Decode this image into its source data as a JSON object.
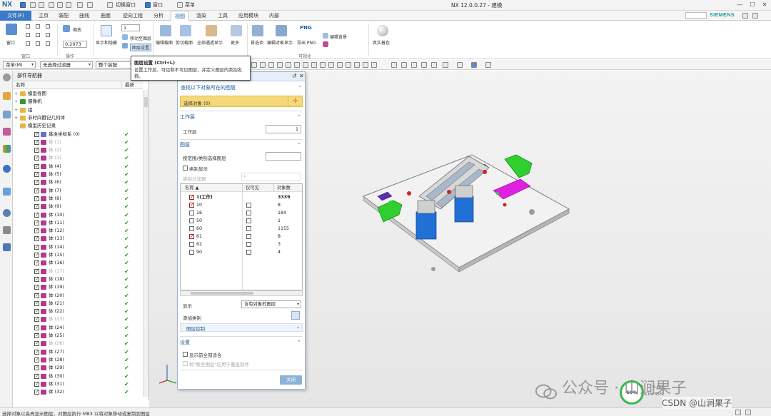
{
  "titlebar": {
    "app_logo": "NX",
    "window_switch_label": "切换窗口",
    "window_menu_label": "窗口",
    "menu_label": "菜单",
    "title": "NX 12.0.0.27 - 建模",
    "brand": "SIEMENS"
  },
  "tabs": [
    {
      "label": "文件(F)"
    },
    {
      "label": "主页"
    },
    {
      "label": "装配"
    },
    {
      "label": "曲线"
    },
    {
      "label": "曲面"
    },
    {
      "label": "逆向工程"
    },
    {
      "label": "分析"
    },
    {
      "label": "视图"
    },
    {
      "label": "渲染"
    },
    {
      "label": "工具"
    },
    {
      "label": "应用模块"
    },
    {
      "label": "内部"
    }
  ],
  "ribbon": {
    "window_btn": "窗口",
    "scale_btn": "缩放",
    "scale_value": "0.2073",
    "layer_value": "1",
    "move_to_layer": "移动至图层",
    "layer_settings": "图层设置",
    "show_hide": "显示和隐藏",
    "edit_section": "编辑截面",
    "clip_section": "剪切截面",
    "all_visible": "全部通透显示",
    "more": "更多",
    "first_select": "首选项",
    "edit_object_display": "编辑对象显示",
    "export_png": "导出 PNG",
    "edit_bg": "编辑背景",
    "faded": "真实着色",
    "png_label": "PNG",
    "group_window": "窗口",
    "group_zoom": "操作",
    "group_visible": "可视化"
  },
  "tooltip": {
    "title": "图层设置 (Ctrl+L)",
    "desc": "设置工作层、可见和不可见图层，并定义图层的类别名称。"
  },
  "filterbar": {
    "menu": "菜单(M)",
    "filter": "无选择过滤器",
    "scope": "整个装配"
  },
  "navigator": {
    "title": "部件导航器",
    "col_name": "名称",
    "col_latest": "最新",
    "rows": [
      {
        "label": "模型视图",
        "level": 0,
        "type": "folder",
        "expand": "+",
        "check": false,
        "tick": false,
        "dim": false
      },
      {
        "label": "摄像机",
        "level": 0,
        "type": "camera",
        "expand": "+",
        "check": false,
        "tick": false,
        "dim": false
      },
      {
        "label": "组",
        "level": 0,
        "type": "folder",
        "expand": "+",
        "check": false,
        "tick": false,
        "dim": false
      },
      {
        "label": "非时间戳记几何体",
        "level": 0,
        "type": "folder",
        "expand": "+",
        "check": false,
        "tick": false,
        "dim": false
      },
      {
        "label": "模型历史记录",
        "level": 0,
        "type": "folder",
        "expand": "-",
        "check": false,
        "tick": false,
        "dim": false
      },
      {
        "label": "基准坐标系 (0)",
        "level": 1,
        "type": "csys",
        "expand": "",
        "check": true,
        "tick": true,
        "dim": false
      },
      {
        "label": "体 (1)",
        "level": 1,
        "type": "body",
        "expand": "",
        "check": true,
        "tick": true,
        "dim": true
      },
      {
        "label": "体 (2)",
        "level": 1,
        "type": "body",
        "expand": "",
        "check": true,
        "tick": true,
        "dim": true
      },
      {
        "label": "体 (3)",
        "level": 1,
        "type": "body",
        "expand": "",
        "check": true,
        "tick": true,
        "dim": true
      },
      {
        "label": "体 (4)",
        "level": 1,
        "type": "body",
        "expand": "",
        "check": true,
        "tick": true,
        "dim": false
      },
      {
        "label": "体 (5)",
        "level": 1,
        "type": "body",
        "expand": "",
        "check": true,
        "tick": true,
        "dim": false
      },
      {
        "label": "体 (6)",
        "level": 1,
        "type": "body",
        "expand": "",
        "check": true,
        "tick": true,
        "dim": false
      },
      {
        "label": "体 (7)",
        "level": 1,
        "type": "body",
        "expand": "",
        "check": true,
        "tick": true,
        "dim": false
      },
      {
        "label": "体 (8)",
        "level": 1,
        "type": "body",
        "expand": "",
        "check": true,
        "tick": true,
        "dim": false
      },
      {
        "label": "体 (9)",
        "level": 1,
        "type": "body",
        "expand": "",
        "check": true,
        "tick": true,
        "dim": false
      },
      {
        "label": "体 (10)",
        "level": 1,
        "type": "body",
        "expand": "",
        "check": true,
        "tick": true,
        "dim": false
      },
      {
        "label": "体 (11)",
        "level": 1,
        "type": "body",
        "expand": "",
        "check": true,
        "tick": true,
        "dim": false
      },
      {
        "label": "体 (12)",
        "level": 1,
        "type": "body",
        "expand": "",
        "check": true,
        "tick": true,
        "dim": false
      },
      {
        "label": "体 (13)",
        "level": 1,
        "type": "body",
        "expand": "",
        "check": true,
        "tick": true,
        "dim": false
      },
      {
        "label": "体 (14)",
        "level": 1,
        "type": "body",
        "expand": "",
        "check": true,
        "tick": true,
        "dim": false
      },
      {
        "label": "体 (15)",
        "level": 1,
        "type": "body",
        "expand": "",
        "check": true,
        "tick": true,
        "dim": false
      },
      {
        "label": "体 (16)",
        "level": 1,
        "type": "body",
        "expand": "",
        "check": true,
        "tick": true,
        "dim": false
      },
      {
        "label": "体 (17)",
        "level": 1,
        "type": "body",
        "expand": "",
        "check": true,
        "tick": true,
        "dim": true
      },
      {
        "label": "体 (18)",
        "level": 1,
        "type": "body",
        "expand": "",
        "check": true,
        "tick": true,
        "dim": false
      },
      {
        "label": "体 (19)",
        "level": 1,
        "type": "body",
        "expand": "",
        "check": true,
        "tick": true,
        "dim": false
      },
      {
        "label": "体 (20)",
        "level": 1,
        "type": "body",
        "expand": "",
        "check": true,
        "tick": true,
        "dim": false
      },
      {
        "label": "体 (21)",
        "level": 1,
        "type": "body",
        "expand": "",
        "check": true,
        "tick": true,
        "dim": false
      },
      {
        "label": "体 (22)",
        "level": 1,
        "type": "body",
        "expand": "",
        "check": true,
        "tick": true,
        "dim": false
      },
      {
        "label": "体 (23)",
        "level": 1,
        "type": "body",
        "expand": "",
        "check": true,
        "tick": true,
        "dim": true
      },
      {
        "label": "体 (24)",
        "level": 1,
        "type": "body",
        "expand": "",
        "check": true,
        "tick": true,
        "dim": false
      },
      {
        "label": "体 (25)",
        "level": 1,
        "type": "body",
        "expand": "",
        "check": true,
        "tick": true,
        "dim": false
      },
      {
        "label": "体 (26)",
        "level": 1,
        "type": "body",
        "expand": "",
        "check": true,
        "tick": true,
        "dim": true
      },
      {
        "label": "体 (27)",
        "level": 1,
        "type": "body",
        "expand": "",
        "check": true,
        "tick": true,
        "dim": false
      },
      {
        "label": "体 (28)",
        "level": 1,
        "type": "body",
        "expand": "",
        "check": true,
        "tick": true,
        "dim": false
      },
      {
        "label": "体 (29)",
        "level": 1,
        "type": "body",
        "expand": "",
        "check": true,
        "tick": true,
        "dim": false
      },
      {
        "label": "体 (30)",
        "level": 1,
        "type": "body",
        "expand": "",
        "check": true,
        "tick": true,
        "dim": false
      },
      {
        "label": "体 (31)",
        "level": 1,
        "type": "body",
        "expand": "",
        "check": true,
        "tick": true,
        "dim": false
      },
      {
        "label": "体 (32)",
        "level": 1,
        "type": "body",
        "expand": "",
        "check": true,
        "tick": true,
        "dim": false
      }
    ]
  },
  "dialog": {
    "sec_find": "查找以下对象所在的图层",
    "select_object": "选择对象 (0)",
    "sec_work": "工作层",
    "work_layer_label": "工作层",
    "work_layer_value": "1",
    "sec_layer": "图层",
    "by_range": "按范围/类别选择图层",
    "category_show": "类别显示",
    "category_filter": "类别过滤器",
    "filter_value": "*",
    "col_name": "名称",
    "col_visible": "仅可见",
    "col_count": "对象数",
    "layers": [
      {
        "name": "1(工作)",
        "checked": true,
        "work": true,
        "visible_box": false,
        "count": "3339"
      },
      {
        "name": "10",
        "checked": true,
        "work": false,
        "visible_box": true,
        "count": "8"
      },
      {
        "name": "16",
        "checked": false,
        "work": false,
        "visible_box": true,
        "count": "184"
      },
      {
        "name": "50",
        "checked": false,
        "work": false,
        "visible_box": true,
        "count": "1"
      },
      {
        "name": "60",
        "checked": false,
        "work": false,
        "visible_box": true,
        "count": "1155"
      },
      {
        "name": "61",
        "checked": true,
        "work": false,
        "visible_box": true,
        "count": "8"
      },
      {
        "name": "62",
        "checked": false,
        "work": false,
        "visible_box": true,
        "count": "3"
      },
      {
        "name": "90",
        "checked": false,
        "work": false,
        "visible_box": true,
        "count": "4"
      }
    ],
    "show_label": "显示",
    "show_value": "含有对象的图层",
    "add_category": "添加类别",
    "layer_control": "图层控制",
    "sec_settings": "设置",
    "fit_all": "显示前全部适合",
    "note": "将\"移至图层\"应用于覆盖部件",
    "close": "关闭"
  },
  "status_text": "选择对象以高亮显示图层，对图层执行 MB3 以将对象移动或复制到图层",
  "perf": {
    "value": "60%",
    "label1": "0.4K/s",
    "label2": "CPU 55%"
  },
  "watermark": {
    "text": "公众号 · 山涧果子",
    "csdn": "CSDN @山涧果子"
  },
  "colors": {
    "accent": "#3b7ac6",
    "select_yellow": "#f5d87a",
    "check_green": "#23a023"
  }
}
